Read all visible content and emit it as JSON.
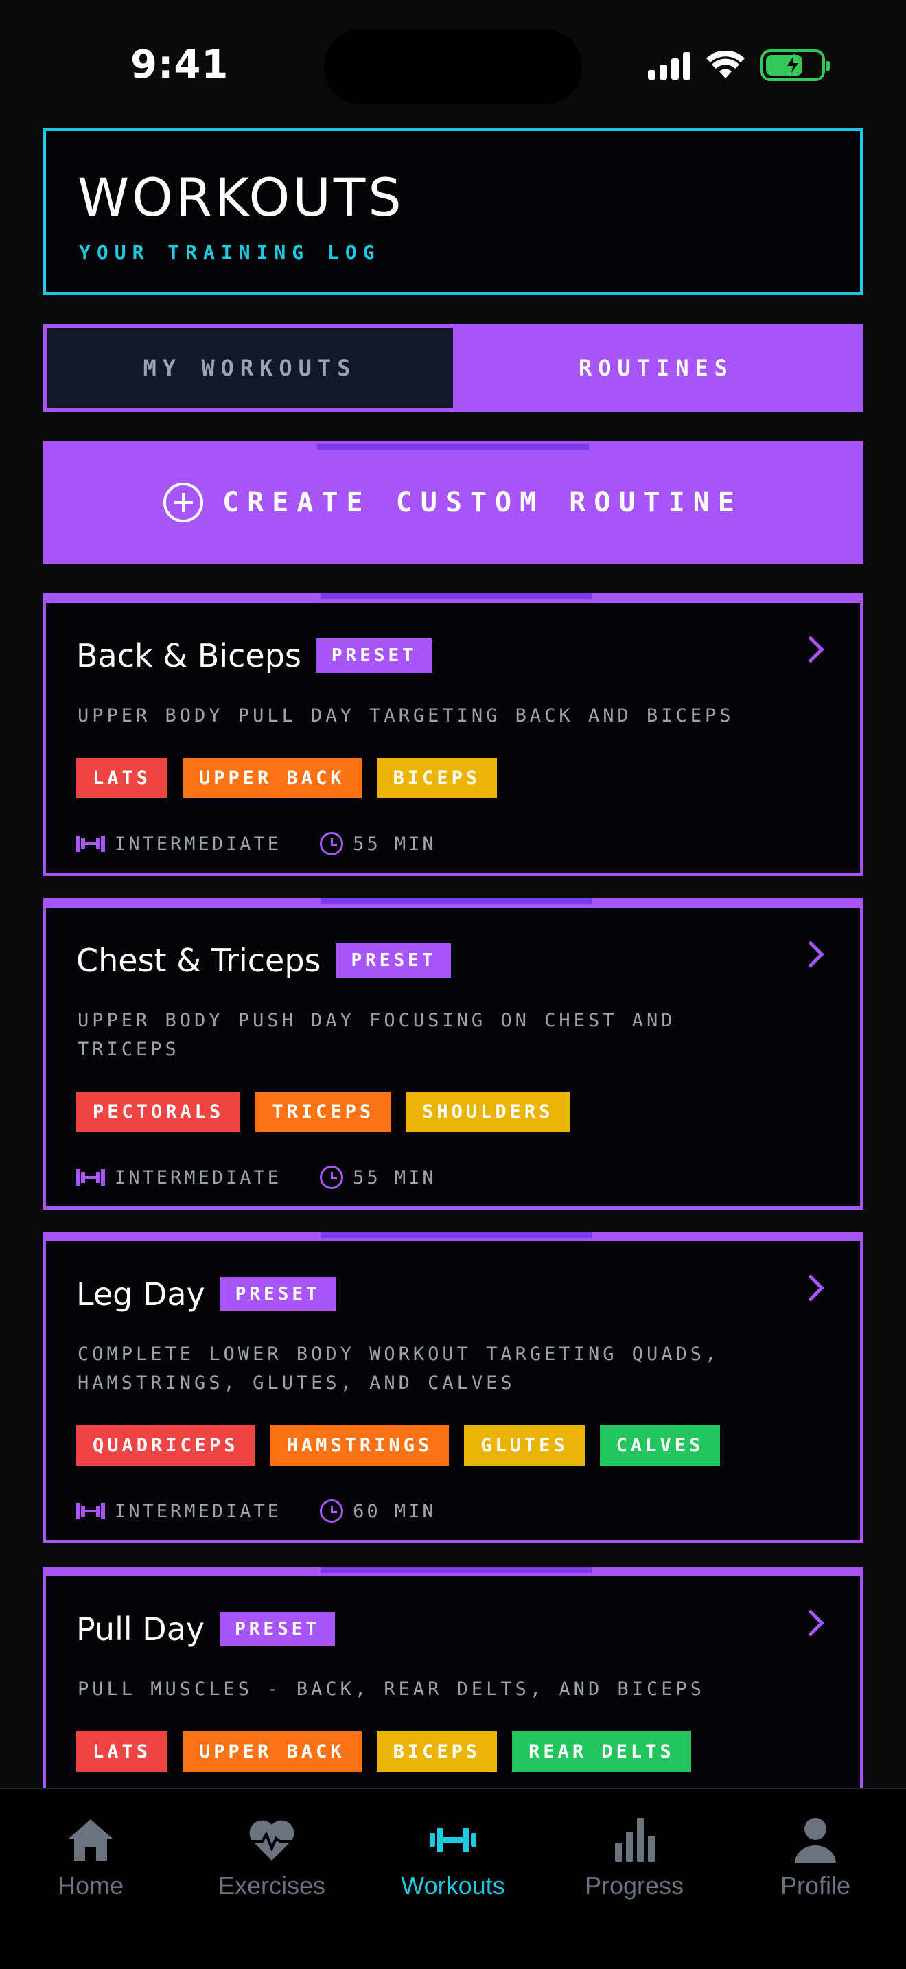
{
  "status_bar": {
    "time": "9:41"
  },
  "header": {
    "title": "WORKOUTS",
    "subtitle": "YOUR TRAINING LOG"
  },
  "tabs": [
    {
      "label": "MY WORKOUTS",
      "active": false
    },
    {
      "label": "ROUTINES",
      "active": true
    }
  ],
  "create_button": {
    "label": "CREATE CUSTOM ROUTINE"
  },
  "routines": [
    {
      "title": "Back & Biceps",
      "badge": "PRESET",
      "description": "UPPER BODY PULL DAY TARGETING BACK AND BICEPS",
      "tags": [
        "LATS",
        "UPPER BACK",
        "BICEPS"
      ],
      "level": "INTERMEDIATE",
      "duration": "55 MIN"
    },
    {
      "title": "Chest & Triceps",
      "badge": "PRESET",
      "description": "UPPER BODY PUSH DAY FOCUSING ON CHEST AND TRICEPS",
      "tags": [
        "PECTORALS",
        "TRICEPS",
        "SHOULDERS"
      ],
      "level": "INTERMEDIATE",
      "duration": "55 MIN"
    },
    {
      "title": "Leg Day",
      "badge": "PRESET",
      "description": "COMPLETE LOWER BODY WORKOUT TARGETING QUADS, HAMSTRINGS, GLUTES, AND CALVES",
      "tags": [
        "QUADRICEPS",
        "HAMSTRINGS",
        "GLUTES",
        "CALVES"
      ],
      "level": "INTERMEDIATE",
      "duration": "60 MIN"
    },
    {
      "title": "Pull Day",
      "badge": "PRESET",
      "description": "PULL MUSCLES - BACK, REAR DELTS, AND BICEPS",
      "tags": [
        "LATS",
        "UPPER BACK",
        "BICEPS",
        "REAR DELTS"
      ]
    }
  ],
  "bottom_nav": [
    {
      "label": "Home",
      "icon": "home-icon",
      "active": false
    },
    {
      "label": "Exercises",
      "icon": "heart-pulse-icon",
      "active": false
    },
    {
      "label": "Workouts",
      "icon": "dumbbell-icon",
      "active": true
    },
    {
      "label": "Progress",
      "icon": "bar-chart-icon",
      "active": false
    },
    {
      "label": "Profile",
      "icon": "user-icon",
      "active": false
    }
  ],
  "colors": {
    "accent": "#a855f7",
    "cyan": "#22c7e0",
    "tag_red": "#ef4444",
    "tag_orange": "#f97316",
    "tag_yellow": "#eab308",
    "tag_green": "#22c55e"
  }
}
